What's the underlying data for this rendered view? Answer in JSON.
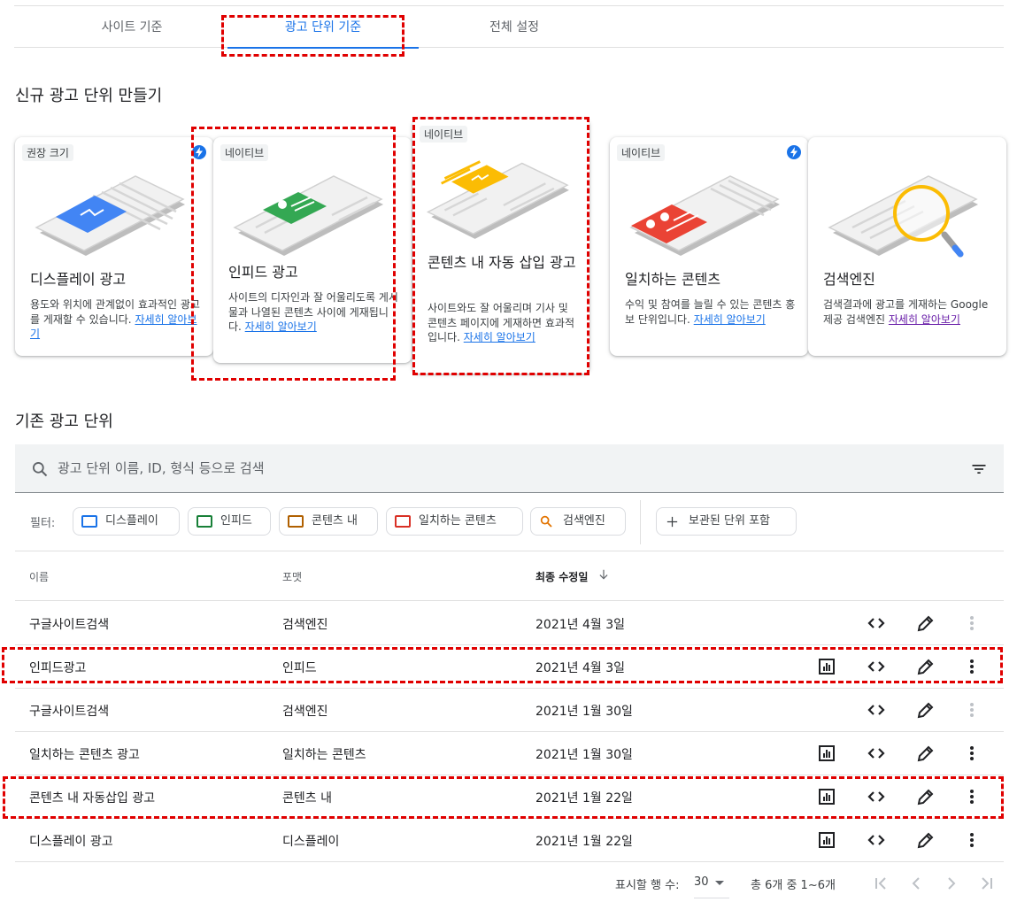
{
  "tabs": [
    {
      "label": "사이트 기준"
    },
    {
      "label": "광고 단위 기준"
    },
    {
      "label": "전체 설정"
    }
  ],
  "new_section_title": "신규 광고 단위 만들기",
  "cards": [
    {
      "badge": "권장 크기",
      "title": "디스플레이 광고",
      "desc": "용도와 위치에 관계없이 효과적인 광고를 게재할 수 있습니다. ",
      "link": "자세히 알아보기",
      "icon": "display-ad-illustration"
    },
    {
      "badge": "네이티브",
      "title": "인피드 광고",
      "desc": "사이트의 디자인과 잘 어울리도록 게시물과 나열된 콘텐츠 사이에 게재됩니다. ",
      "link": "자세히 알아보기",
      "icon": "infeed-ad-illustration"
    },
    {
      "badge": "네이티브",
      "title": "콘텐츠 내 자동 삽입 광고",
      "desc": "사이트와도 잘 어울리며 기사 및 콘텐츠 페이지에 게재하면 효과적입니다. ",
      "link": "자세히 알아보기",
      "icon": "in-article-ad-illustration"
    },
    {
      "badge": "네이티브",
      "title": "일치하는 콘텐츠",
      "desc": "수익 및 참여를 늘릴 수 있는 콘텐츠 홍보 단위입니다. ",
      "link": "자세히 알아보기",
      "icon": "matched-content-illustration"
    },
    {
      "badge": "",
      "title": "검색엔진",
      "desc": "검색결과에 광고를 게재하는 Google 제공 검색엔진 ",
      "link": "자세히 알아보기",
      "icon": "search-engine-illustration"
    }
  ],
  "existing_section_title": "기존 광고 단위",
  "search": {
    "placeholder": "광고 단위 이름, ID, 형식 등으로 검색"
  },
  "filters": {
    "label": "필터:",
    "chips": [
      {
        "label": "디스플레이",
        "color": "#1a73e8"
      },
      {
        "label": "인피드",
        "color": "#188038"
      },
      {
        "label": "콘텐츠 내",
        "color": "#b06000"
      },
      {
        "label": "일치하는 콘텐츠",
        "color": "#d93025"
      },
      {
        "label": "검색엔진",
        "color": "#e37400"
      }
    ],
    "archived": "보관된 단위 포함"
  },
  "table": {
    "headers": {
      "name": "이름",
      "format": "포맷",
      "modified": "최종 수정일"
    },
    "rows": [
      {
        "name": "구글사이트검색",
        "format": "검색엔진",
        "date": "2021년 4월 3일",
        "report": false,
        "more_disabled": true
      },
      {
        "name": "인피드광고",
        "format": "인피드",
        "date": "2021년 4월 3일",
        "report": true,
        "more_disabled": false
      },
      {
        "name": "구글사이트검색",
        "format": "검색엔진",
        "date": "2021년 1월 30일",
        "report": false,
        "more_disabled": true
      },
      {
        "name": "일치하는 콘텐츠 광고",
        "format": "일치하는 콘텐츠",
        "date": "2021년 1월 30일",
        "report": true,
        "more_disabled": false
      },
      {
        "name": "콘텐츠 내 자동삽입 광고",
        "format": "콘텐츠 내",
        "date": "2021년 1월 22일",
        "report": true,
        "more_disabled": false
      },
      {
        "name": "디스플레이 광고",
        "format": "디스플레이",
        "date": "2021년 1월 22일",
        "report": true,
        "more_disabled": false
      }
    ]
  },
  "pager": {
    "rows_label": "표시할 행 수:",
    "rows_value": "30",
    "range": "총 6개 중 1~6개"
  },
  "colors": {
    "accent": "#1a73e8",
    "highlight": "#e00000"
  }
}
